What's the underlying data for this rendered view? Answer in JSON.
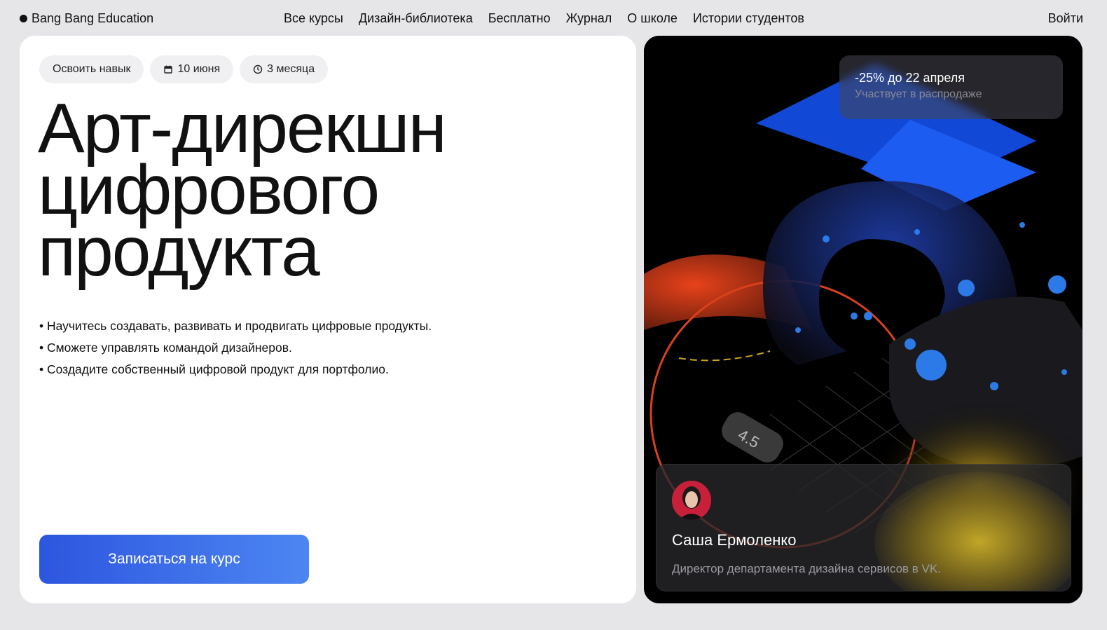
{
  "header": {
    "logo": "Bang Bang Education",
    "nav": [
      "Все курсы",
      "Дизайн-библиотека",
      "Бесплатно",
      "Журнал",
      "О школе",
      "Истории студентов"
    ],
    "login": "Войти"
  },
  "course": {
    "chips": {
      "skill": "Освоить навык",
      "date": "10 июня",
      "duration": "3 месяца"
    },
    "title_lines": [
      "Арт-дирекшн",
      "цифрового",
      "продукта"
    ],
    "bullets": [
      "Научитесь создавать, развивать и продвигать цифровые продукты.",
      "Сможете управлять командой дизайнеров.",
      "Создадите собственный цифровой продукт для портфолио."
    ],
    "cta": "Записаться на курс"
  },
  "promo": {
    "title": "-25% до 22 апреля",
    "subtitle": "Участвует в распродаже"
  },
  "artwork": {
    "tile_label": "4.5"
  },
  "instructor": {
    "name": "Саша Ермоленко",
    "role": "Директор департамента дизайна сервисов в VK."
  },
  "colors": {
    "accent_start": "#2d56df",
    "accent_end": "#4d86f2",
    "page_bg": "#e6e6e9"
  }
}
